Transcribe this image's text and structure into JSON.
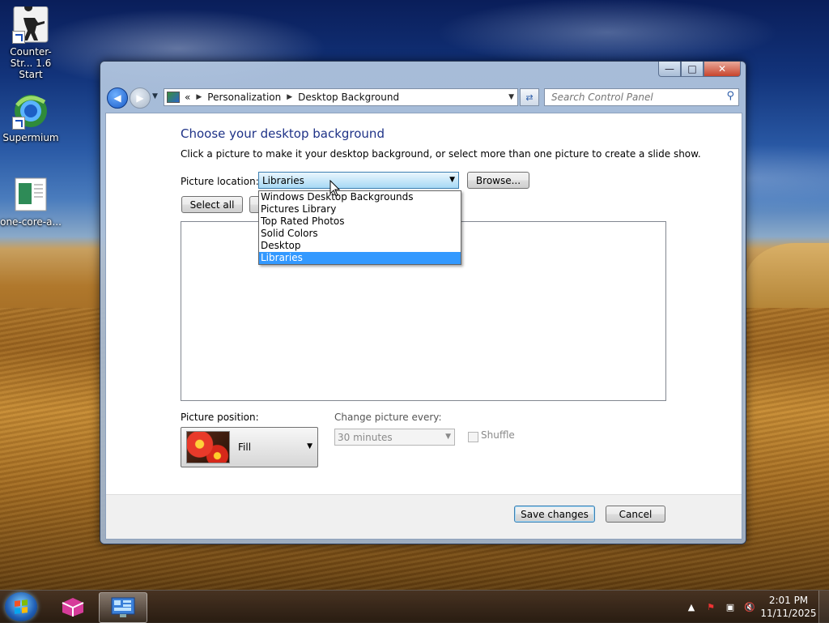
{
  "desktop": {
    "icons": [
      {
        "label": "Counter-Str... 1.6 Start",
        "icon": "counter-strike-icon"
      },
      {
        "label": "Supermium",
        "icon": "supermium-icon"
      },
      {
        "label": "one-core-a...",
        "icon": "document-icon"
      }
    ]
  },
  "window": {
    "controls": {
      "minimize": "—",
      "maximize": "□",
      "close": "✕"
    },
    "address": {
      "overflow": "«",
      "crumbs": [
        "Personalization",
        "Desktop Background"
      ]
    },
    "search": {
      "placeholder": "Search Control Panel"
    }
  },
  "page": {
    "title": "Choose your desktop background",
    "description": "Click a picture to make it your desktop background, or select more than one picture to create a slide show.",
    "location_label": "Picture location:",
    "location_value": "Libraries",
    "browse_label": "Browse...",
    "select_all_label": "Select all",
    "location_options": [
      "Windows Desktop Backgrounds",
      "Pictures Library",
      "Top Rated Photos",
      "Solid Colors",
      "Desktop",
      "Libraries"
    ],
    "location_selected_index": 5,
    "position_label": "Picture position:",
    "position_value": "Fill",
    "change_label": "Change picture every:",
    "change_value": "30 minutes",
    "shuffle_label": "Shuffle",
    "shuffle_checked": false,
    "save_label": "Save changes",
    "cancel_label": "Cancel"
  },
  "taskbar": {
    "time": "2:01 PM",
    "date": "11/11/2025"
  },
  "colors": {
    "accent": "#3399ff",
    "title": "#1e3287"
  }
}
